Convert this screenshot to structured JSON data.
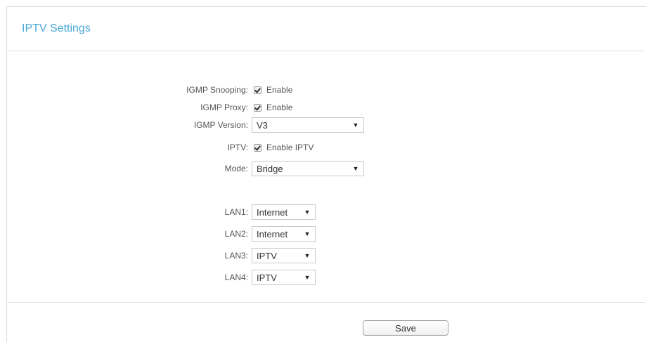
{
  "panel": {
    "title": "IPTV Settings"
  },
  "igmp_snooping": {
    "label": "IGMP Snooping:",
    "checkbox_label": "Enable",
    "checked": true
  },
  "igmp_proxy": {
    "label": "IGMP Proxy:",
    "checkbox_label": "Enable",
    "checked": true
  },
  "igmp_version": {
    "label": "IGMP Version:",
    "value": "V3"
  },
  "iptv": {
    "label": "IPTV:",
    "checkbox_label": "Enable IPTV",
    "checked": true
  },
  "mode": {
    "label": "Mode:",
    "value": "Bridge"
  },
  "lan_ports": [
    {
      "label": "LAN1:",
      "value": "Internet"
    },
    {
      "label": "LAN2:",
      "value": "Internet"
    },
    {
      "label": "LAN3:",
      "value": "IPTV"
    },
    {
      "label": "LAN4:",
      "value": "IPTV"
    }
  ],
  "actions": {
    "save_label": "Save"
  },
  "icons": {
    "dropdown": "triangle-down-icon",
    "check": "checkmark-icon"
  },
  "colors": {
    "title": "#4aa8d8",
    "label_text": "#555555",
    "border": "#d9d9d9"
  }
}
